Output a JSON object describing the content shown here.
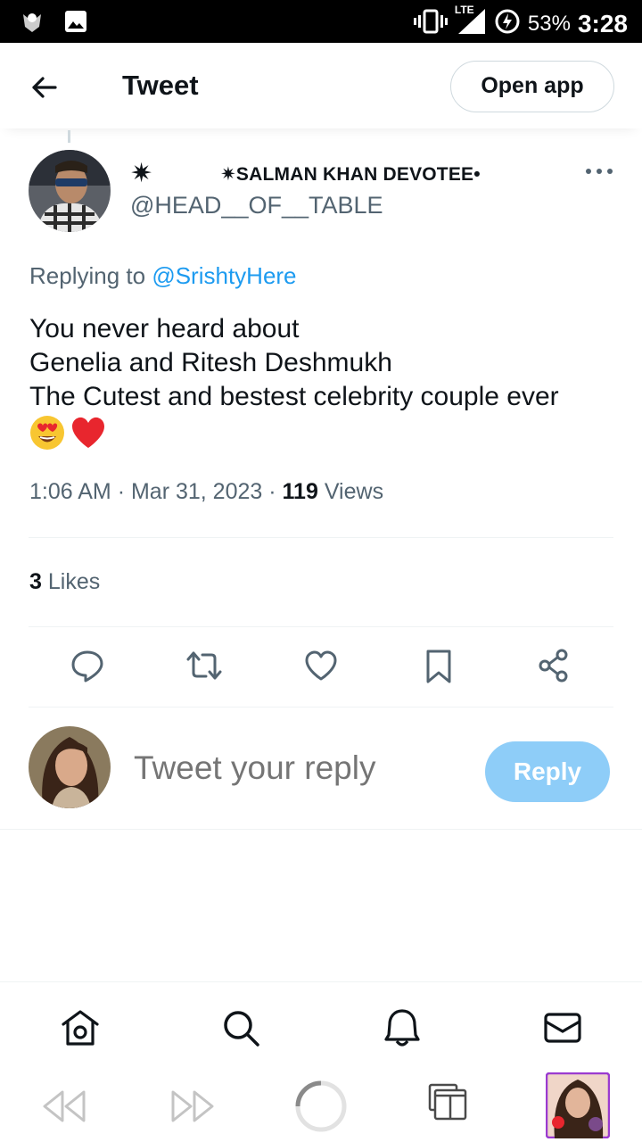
{
  "status_bar": {
    "network": "LTE",
    "battery_pct": "53%",
    "time": "3:28",
    "icons": [
      "app-notification-icon",
      "image-icon",
      "vibrate-icon",
      "signal-icon",
      "battery-charging-icon"
    ]
  },
  "header": {
    "title": "Tweet",
    "open_app_label": "Open app"
  },
  "tweet": {
    "author_star": "✷",
    "author_name": "✷SALMAN KHAN DEVOTEE•",
    "author_handle": "@HEAD__OF__TABLE",
    "replying_prefix": "Replying to",
    "replying_to": "@SrishtyHere",
    "text_lines": [
      "You never heard about",
      "Genelia and Ritesh Deshmukh",
      "The Cutest and bestest celebrity couple ever"
    ],
    "emojis": [
      "heart-eyes-emoji",
      "red-heart-emoji"
    ],
    "time": "1:06 AM",
    "date": "Mar 31, 2023",
    "views_count": "119",
    "views_label": "Views",
    "likes_count": "3",
    "likes_label": "Likes"
  },
  "actions": [
    "reply-icon",
    "retweet-icon",
    "like-icon",
    "bookmark-icon",
    "share-icon"
  ],
  "reply_box": {
    "placeholder": "Tweet your reply",
    "button_label": "Reply"
  },
  "bottom_nav": [
    "home-icon",
    "search-icon",
    "notifications-icon",
    "messages-icon"
  ],
  "browser_bar": [
    "back-icon",
    "forward-icon",
    "reload-icon",
    "tabs-icon",
    "profile-thumbnail"
  ],
  "colors": {
    "accent": "#1d9bf0",
    "reply_button": "#8ecdf8",
    "secondary_text": "#536471",
    "divider": "#eff3f4"
  }
}
